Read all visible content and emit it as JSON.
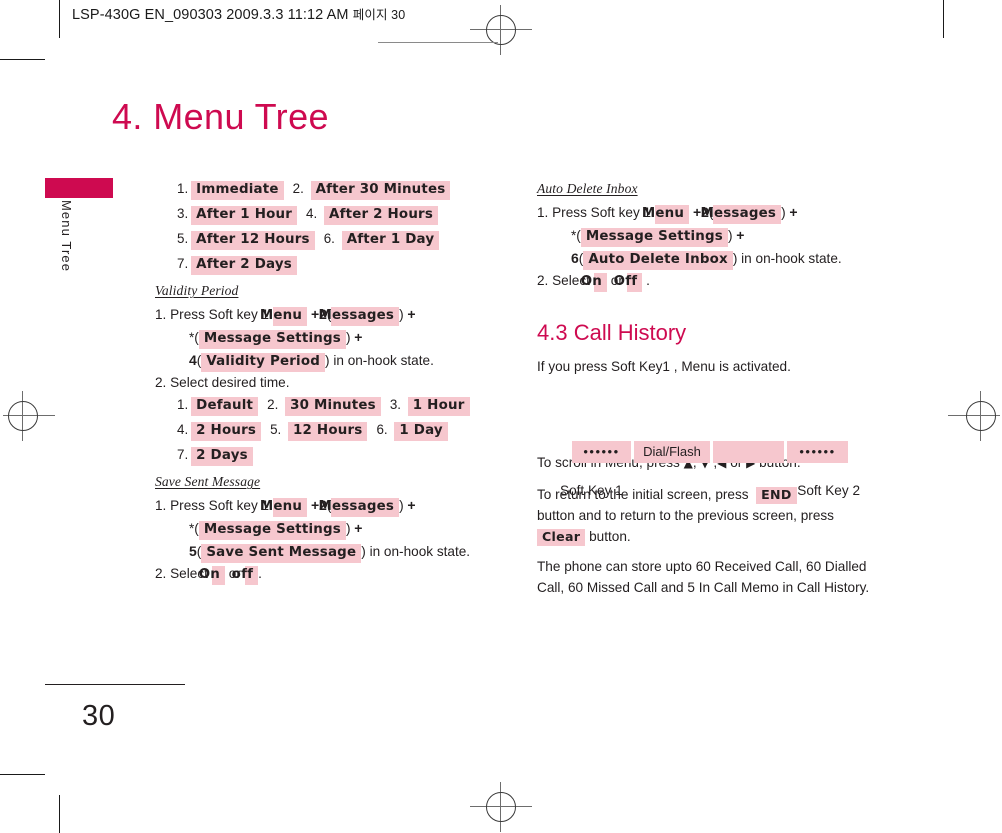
{
  "print": {
    "slug": "LSP-430G EN_090303  2009.3.3 11:12 AM",
    "slug_kr": "페이지 30"
  },
  "sidebar": {
    "tab_label": "Menu Tree",
    "tab_color": "#ce0a50"
  },
  "chapter": {
    "title": "4. Menu Tree",
    "title_color": "#ce0a50"
  },
  "highlight_color": "#f6c7ce",
  "left_column": {
    "delivery_options": {
      "rows": [
        [
          {
            "no": "1.",
            "label": "Immediate"
          },
          {
            "no": "2.",
            "label": "After 30 Minutes"
          }
        ],
        [
          {
            "no": "3.",
            "label": "After 1 Hour"
          },
          {
            "no": "4.",
            "label": "After 2 Hours"
          }
        ],
        [
          {
            "no": "5.",
            "label": "After 12 Hours"
          },
          {
            "no": "6.",
            "label": "After 1 Day"
          }
        ],
        [
          {
            "no": "7.",
            "label": "After 2 Days"
          }
        ]
      ]
    },
    "validity_period": {
      "heading": "Validity Period",
      "step1_prefix": "1. Press Soft key 1",
      "chip_menu": "Menu",
      "plus": "+",
      "num2": "2",
      "chip_messages": "Messages",
      "star": "*",
      "chip_message_settings": "Message Settings",
      "num4": "4",
      "chip_validity_period": "Validity Period",
      "onhook": ") in on-hook state.",
      "step2": "2. Select desired time.",
      "rows": [
        [
          {
            "no": "1.",
            "label": "Default"
          },
          {
            "no": "2.",
            "label": "30 Minutes"
          },
          {
            "no": "3.",
            "label": "1 Hour"
          }
        ],
        [
          {
            "no": "4.",
            "label": "2 Hours"
          },
          {
            "no": "5.",
            "label": "12 Hours"
          },
          {
            "no": "6.",
            "label": "1 Day"
          }
        ],
        [
          {
            "no": "7.",
            "label": "2 Days"
          }
        ]
      ]
    },
    "save_sent_message": {
      "heading": "Save Sent Message",
      "step1_prefix": "1. Press Soft key 1",
      "chip_menu": "Menu",
      "num2": "2",
      "chip_messages": "Messages",
      "star": "*",
      "chip_message_settings": "Message Settings",
      "num5": "5",
      "chip_save_sent_message": "Save Sent Message",
      "onhook": ") in on-hook state.",
      "step2_prefix": "2. Select",
      "chip_on": "On",
      "or": "or",
      "chip_off": "off",
      "period": "."
    }
  },
  "right_column": {
    "auto_delete_inbox": {
      "heading": "Auto Delete Inbox",
      "step1_prefix": "1. Press Soft key 1",
      "chip_menu": "Menu",
      "num2": "2",
      "chip_messages": "Messages",
      "star": "*",
      "chip_message_settings": "Message Settings",
      "num6": "6",
      "chip_auto_delete_inbox": "Auto Delete Inbox",
      "onhook": ") in on-hook state.",
      "step2_prefix": "2. Select",
      "chip_on": "On",
      "or": "or",
      "chip_off": "Off",
      "period": "."
    },
    "call_history": {
      "title": "4.3 Call History",
      "intro": "If you press Soft Key1 , Menu is activated.",
      "keystrip": [
        {
          "type": "dots",
          "label": "••••••"
        },
        {
          "type": "text",
          "label": "Dial/Flash"
        },
        {
          "type": "blank",
          "label": ""
        },
        {
          "type": "dots",
          "label": "••••••"
        }
      ],
      "softkey_left": "Soft Key 1",
      "softkey_right": "Soft Key 2",
      "scroll_text_a": "To scroll in Menu, press",
      "scroll_up": "▲",
      "scroll_comma1": ",",
      "scroll_down": "▼",
      "scroll_comma2": ",",
      "scroll_left": "◀",
      "scroll_or": "or",
      "scroll_right": "▶",
      "scroll_text_b": "button.",
      "return_a": "To return to the initial screen, press",
      "chip_end": "END",
      "return_b": "button and to return to the previous screen, press",
      "chip_clear": "Clear",
      "return_c": "button.",
      "storage": "The phone can store upto 60 Received Call, 60 Dialled Call, 60 Missed Call and 5 In Call Memo in Call History."
    }
  },
  "footer": {
    "page_number": "30"
  }
}
